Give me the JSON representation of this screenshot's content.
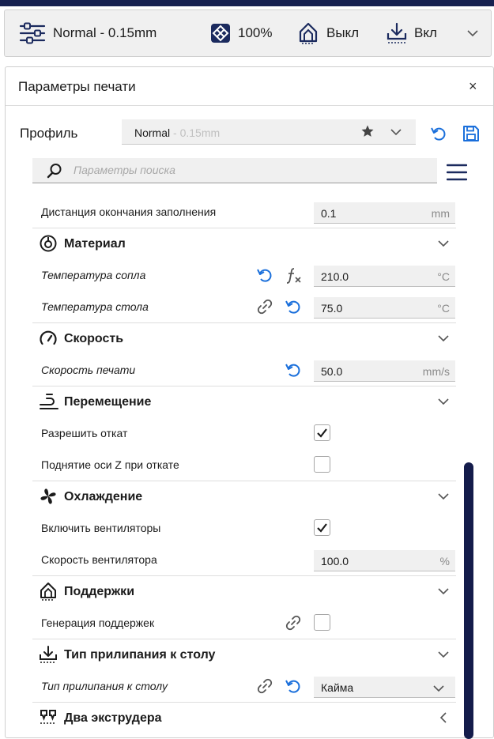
{
  "colors": {
    "accent": "#1a6fdb",
    "navy": "#172150",
    "dark_text": "#1b1b1b",
    "muted_text": "#8a8a8a"
  },
  "topbar": {
    "profile_text": "Normal - 0.15mm",
    "infill_text": "100%",
    "support_text": "Выкл",
    "adhesion_text": "Вкл",
    "icons": [
      "sliders-icon",
      "infill-icon",
      "support-icon",
      "adhesion-icon",
      "chevron-down-icon"
    ]
  },
  "panel": {
    "title": "Параметры печати",
    "close_label": "×"
  },
  "profile": {
    "label": "Профиль",
    "name": "Normal",
    "layer": " - 0.15mm"
  },
  "search": {
    "placeholder": "Параметры поиска"
  },
  "settings": {
    "infill_end_distance": {
      "label": "Дистанция окончания заполнения",
      "value": "0.1",
      "unit": "mm"
    },
    "material": {
      "title": "Материал",
      "nozzle_temp": {
        "label": "Температура сопла",
        "value": "210.0",
        "unit": "°C"
      },
      "bed_temp": {
        "label": "Температура стола",
        "value": "75.0",
        "unit": "°C"
      }
    },
    "speed": {
      "title": "Скорость",
      "print_speed": {
        "label": "Скорость печати",
        "value": "50.0",
        "unit": "mm/s"
      }
    },
    "travel": {
      "title": "Перемещение",
      "enable_retraction": {
        "label": "Разрешить откат",
        "checked": true
      },
      "z_hop": {
        "label": "Поднятие оси Z при откате",
        "checked": false
      }
    },
    "cooling": {
      "title": "Охлаждение",
      "enable_fans": {
        "label": "Включить вентиляторы",
        "checked": true
      },
      "fan_speed": {
        "label": "Скорость вентилятора",
        "value": "100.0",
        "unit": "%"
      }
    },
    "supports": {
      "title": "Поддержки",
      "generate_support": {
        "label": "Генерация поддержек",
        "checked": false
      }
    },
    "adhesion": {
      "title": "Тип прилипания к столу",
      "adhesion_type": {
        "label": "Тип прилипания к столу",
        "value": "Кайма"
      }
    },
    "dual": {
      "title": "Два экструдера"
    }
  }
}
